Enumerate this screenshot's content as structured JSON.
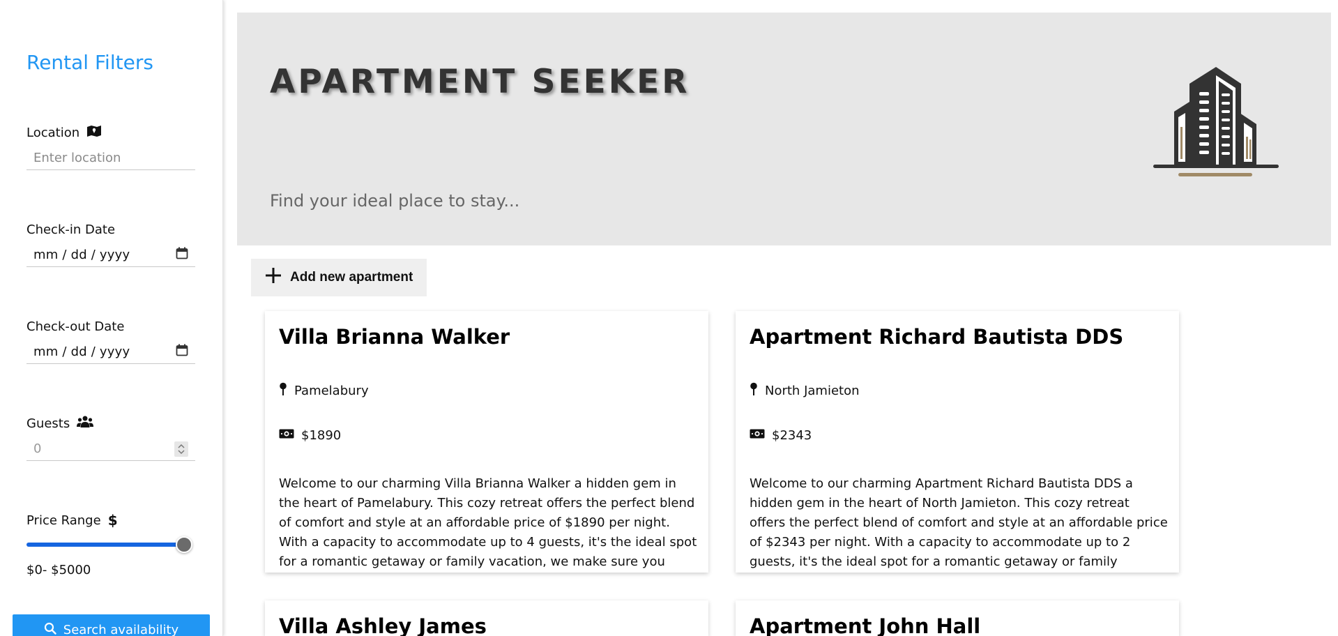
{
  "sidebar": {
    "title": "Rental Filters",
    "location": {
      "label": "Location",
      "placeholder": "Enter location",
      "icon": "map-icon"
    },
    "checkin": {
      "label": "Check-in Date",
      "value": "mm / dd / yyyy",
      "icon": "calendar-icon"
    },
    "checkout": {
      "label": "Check-out Date",
      "value": "mm / dd / yyyy",
      "icon": "calendar-icon"
    },
    "guests": {
      "label": "Guests",
      "value": "0",
      "icon": "users-icon"
    },
    "price": {
      "label": "Price Range",
      "icon": "dollar-icon",
      "range_text": "$0- $5000",
      "slider_fraction": 1.0
    },
    "search_label": "Search availability"
  },
  "header": {
    "title": "APARTMENT SEEKER",
    "subtitle": "Find your ideal place to stay...",
    "logo_icon": "building-logo-icon"
  },
  "add_button_label": "Add new apartment",
  "listings": [
    {
      "title": "Villa Brianna Walker",
      "location": "Pamelabury",
      "price": "$1890",
      "description": "Welcome to our charming Villa Brianna Walker a hidden gem in the heart of Pamelabury. This cozy retreat offers the perfect blend of comfort and style at an affordable price of $1890 per night. With a capacity to accommodate up to 4 guests, it's the ideal spot for a romantic getaway or family vacation, we make sure you enjoy with"
    },
    {
      "title": "Apartment Richard Bautista DDS",
      "location": "North Jamieton",
      "price": "$2343",
      "description": "Welcome to our charming Apartment Richard Bautista DDS a hidden gem in the heart of North Jamieton. This cozy retreat offers the perfect blend of comfort and style at an affordable price of $2343 per night. With a capacity to accommodate up to 2 guests, it's the ideal spot for a romantic getaway or family vacation, we make sure you enjoy with"
    },
    {
      "title": "Villa Ashley James"
    },
    {
      "title": "Apartment John Hall"
    }
  ],
  "colors": {
    "accent": "#2196f3",
    "slider": "#1565e0",
    "header_bg": "#e7e7e7",
    "logo_gold": "#a08a66",
    "logo_dark": "#333333"
  }
}
